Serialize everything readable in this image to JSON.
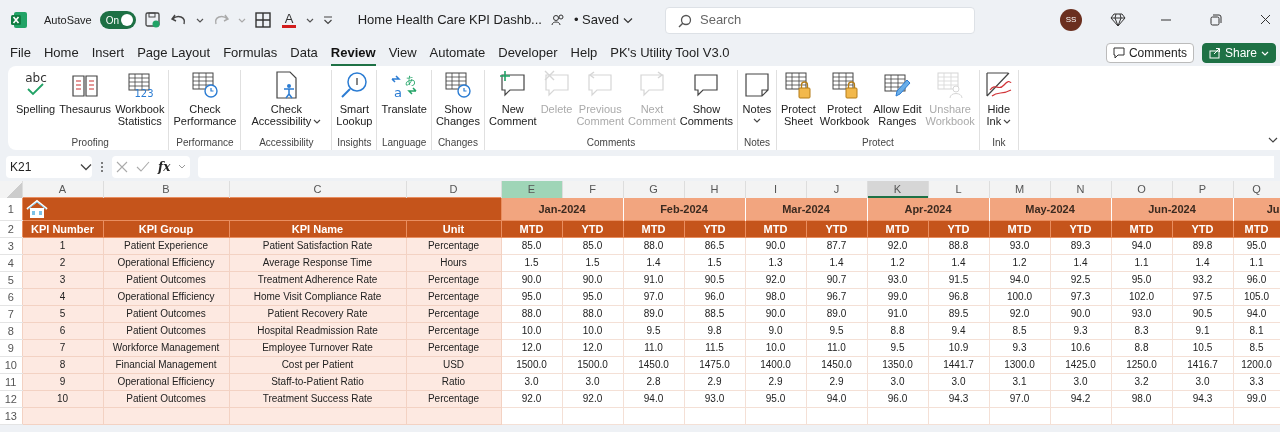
{
  "title_bar": {
    "autosave_label": "AutoSave",
    "autosave_on": true,
    "toggle_text": "On",
    "redo_disabled": true,
    "font_color_glyph": "A",
    "document_title": "Home Health Care KPI Dashb...",
    "save_status": "• Saved",
    "search_placeholder": "Search",
    "avatar_initials": "SS"
  },
  "menu_tabs": [
    {
      "label": "File",
      "selected": false
    },
    {
      "label": "Home",
      "selected": false
    },
    {
      "label": "Insert",
      "selected": false
    },
    {
      "label": "Page Layout",
      "selected": false
    },
    {
      "label": "Formulas",
      "selected": false
    },
    {
      "label": "Data",
      "selected": false
    },
    {
      "label": "Review",
      "selected": true
    },
    {
      "label": "View",
      "selected": false
    },
    {
      "label": "Automate",
      "selected": false
    },
    {
      "label": "Developer",
      "selected": false
    },
    {
      "label": "Help",
      "selected": false
    },
    {
      "label": "PK's Utility Tool V3.0",
      "selected": false
    }
  ],
  "header_buttons": [
    {
      "label": "Comments",
      "kind": "outline"
    },
    {
      "label": "Share",
      "kind": "primary"
    }
  ],
  "ribbon_groups": [
    {
      "label": "Proofing",
      "buttons": [
        {
          "label": "Spelling",
          "disabled": false,
          "dropdown": false,
          "icon_text": [
            "abc"
          ]
        },
        {
          "label": "Thesaurus",
          "disabled": false,
          "dropdown": false
        },
        {
          "label": "Workbook\nStatistics",
          "disabled": false,
          "dropdown": false,
          "icon_text": [
            "123"
          ]
        }
      ]
    },
    {
      "label": "Performance",
      "buttons": [
        {
          "label": "Check\nPerformance",
          "disabled": false,
          "dropdown": false
        }
      ]
    },
    {
      "label": "Accessibility",
      "buttons": [
        {
          "label": "Check\nAccessibility",
          "disabled": false,
          "dropdown": true
        }
      ]
    },
    {
      "label": "Insights",
      "buttons": [
        {
          "label": "Smart\nLookup",
          "disabled": false,
          "dropdown": false
        }
      ]
    },
    {
      "label": "Language",
      "buttons": [
        {
          "label": "Translate",
          "disabled": false,
          "dropdown": false,
          "icon_text": [
            "a",
            "あ"
          ]
        }
      ]
    },
    {
      "label": "Changes",
      "buttons": [
        {
          "label": "Show\nChanges",
          "disabled": false,
          "dropdown": false
        }
      ]
    },
    {
      "label": "Comments",
      "buttons": [
        {
          "label": "New\nComment",
          "disabled": false,
          "dropdown": false
        },
        {
          "label": "Delete",
          "disabled": true,
          "dropdown": false
        },
        {
          "label": "Previous\nComment",
          "disabled": true,
          "dropdown": false
        },
        {
          "label": "Next\nComment",
          "disabled": true,
          "dropdown": false
        },
        {
          "label": "Show\nComments",
          "disabled": false,
          "dropdown": false
        }
      ]
    },
    {
      "label": "Notes",
      "buttons": [
        {
          "label": "Notes",
          "disabled": false,
          "dropdown": true
        }
      ]
    },
    {
      "label": "Protect",
      "buttons": [
        {
          "label": "Protect\nSheet",
          "disabled": false,
          "dropdown": false
        },
        {
          "label": "Protect\nWorkbook",
          "disabled": false,
          "dropdown": false
        },
        {
          "label": "Allow Edit\nRanges",
          "disabled": false,
          "dropdown": false
        },
        {
          "label": "Unshare\nWorkbook",
          "disabled": true,
          "dropdown": false
        }
      ]
    },
    {
      "label": "Ink",
      "buttons": [
        {
          "label": "Hide\nInk",
          "disabled": false,
          "dropdown": true
        }
      ]
    }
  ],
  "formula_bar": {
    "name_box": "K21",
    "function_label": "fx"
  },
  "sheet": {
    "columns": [
      {
        "letter": "A",
        "selected": false,
        "highlighted": false
      },
      {
        "letter": "B",
        "selected": false,
        "highlighted": false
      },
      {
        "letter": "C",
        "selected": false,
        "highlighted": false
      },
      {
        "letter": "D",
        "selected": false,
        "highlighted": false
      },
      {
        "letter": "E",
        "selected": false,
        "highlighted": true
      },
      {
        "letter": "F",
        "selected": false,
        "highlighted": false
      },
      {
        "letter": "G",
        "selected": false,
        "highlighted": false
      },
      {
        "letter": "H",
        "selected": false,
        "highlighted": false
      },
      {
        "letter": "I",
        "selected": false,
        "highlighted": false
      },
      {
        "letter": "J",
        "selected": false,
        "highlighted": false
      },
      {
        "letter": "K",
        "selected": true,
        "highlighted": false
      },
      {
        "letter": "L",
        "selected": false,
        "highlighted": false
      },
      {
        "letter": "M",
        "selected": false,
        "highlighted": false
      },
      {
        "letter": "N",
        "selected": false,
        "highlighted": false
      },
      {
        "letter": "O",
        "selected": false,
        "highlighted": false
      },
      {
        "letter": "P",
        "selected": false,
        "highlighted": false
      },
      {
        "letter": "Q",
        "selected": false,
        "highlighted": false
      }
    ],
    "row_numbers": [
      "1",
      "2",
      "3",
      "4",
      "5",
      "6",
      "7",
      "8",
      "9",
      "10",
      "11",
      "12",
      "13"
    ],
    "headers": [
      "KPI Number",
      "KPI Group",
      "KPI Name",
      "Unit"
    ],
    "months": [
      "Jan-2024",
      "Feb-2024",
      "Mar-2024",
      "Apr-2024",
      "May-2024",
      "Jun-2024",
      "Ju"
    ],
    "subheaders": [
      "MTD",
      "YTD",
      "MTD",
      "YTD",
      "MTD",
      "YTD",
      "MTD",
      "YTD",
      "MTD",
      "YTD",
      "MTD",
      "YTD",
      "MTD"
    ],
    "rows": [
      {
        "cells": [
          "1",
          "Patient Experience",
          "Patient Satisfaction Rate",
          "Percentage"
        ],
        "values": [
          "85.0",
          "85.0",
          "88.0",
          "86.5",
          "90.0",
          "87.7",
          "92.0",
          "88.8",
          "93.0",
          "89.3",
          "94.0",
          "89.8",
          "95.0"
        ]
      },
      {
        "cells": [
          "2",
          "Operational Efficiency",
          "Average Response Time",
          "Hours"
        ],
        "values": [
          "1.5",
          "1.5",
          "1.4",
          "1.5",
          "1.3",
          "1.4",
          "1.2",
          "1.4",
          "1.2",
          "1.4",
          "1.1",
          "1.4",
          "1.1"
        ]
      },
      {
        "cells": [
          "3",
          "Patient Outcomes",
          "Treatment Adherence Rate",
          "Percentage"
        ],
        "values": [
          "90.0",
          "90.0",
          "91.0",
          "90.5",
          "92.0",
          "90.7",
          "93.0",
          "91.5",
          "94.0",
          "92.5",
          "95.0",
          "93.2",
          "96.0"
        ]
      },
      {
        "cells": [
          "4",
          "Operational Efficiency",
          "Home Visit Compliance Rate",
          "Percentage"
        ],
        "values": [
          "95.0",
          "95.0",
          "97.0",
          "96.0",
          "98.0",
          "96.7",
          "99.0",
          "96.8",
          "100.0",
          "97.3",
          "102.0",
          "97.5",
          "105.0"
        ]
      },
      {
        "cells": [
          "5",
          "Patient Outcomes",
          "Patient Recovery Rate",
          "Percentage"
        ],
        "values": [
          "88.0",
          "88.0",
          "89.0",
          "88.5",
          "90.0",
          "89.0",
          "91.0",
          "89.5",
          "92.0",
          "90.0",
          "93.0",
          "90.5",
          "94.0"
        ]
      },
      {
        "cells": [
          "6",
          "Patient Outcomes",
          "Hospital Readmission Rate",
          "Percentage"
        ],
        "values": [
          "10.0",
          "10.0",
          "9.5",
          "9.8",
          "9.0",
          "9.5",
          "8.8",
          "9.4",
          "8.5",
          "9.3",
          "8.3",
          "9.1",
          "8.1"
        ]
      },
      {
        "cells": [
          "7",
          "Workforce Management",
          "Employee Turnover Rate",
          "Percentage"
        ],
        "values": [
          "12.0",
          "12.0",
          "11.0",
          "11.5",
          "10.0",
          "11.0",
          "9.5",
          "10.9",
          "9.3",
          "10.6",
          "8.8",
          "10.5",
          "8.5"
        ]
      },
      {
        "cells": [
          "8",
          "Financial Management",
          "Cost per Patient",
          "USD"
        ],
        "values": [
          "1500.0",
          "1500.0",
          "1450.0",
          "1475.0",
          "1400.0",
          "1450.0",
          "1350.0",
          "1441.7",
          "1300.0",
          "1425.0",
          "1250.0",
          "1416.7",
          "1200.0"
        ]
      },
      {
        "cells": [
          "9",
          "Operational Efficiency",
          "Staff-to-Patient Ratio",
          "Ratio"
        ],
        "values": [
          "3.0",
          "3.0",
          "2.8",
          "2.9",
          "2.9",
          "2.9",
          "3.0",
          "3.0",
          "3.1",
          "3.0",
          "3.2",
          "3.0",
          "3.3"
        ]
      },
      {
        "cells": [
          "10",
          "Patient Outcomes",
          "Treatment Success Rate",
          "Percentage"
        ],
        "values": [
          "92.0",
          "92.0",
          "94.0",
          "93.0",
          "95.0",
          "94.0",
          "96.0",
          "94.3",
          "97.0",
          "94.2",
          "98.0",
          "94.3",
          "99.0"
        ]
      }
    ]
  }
}
